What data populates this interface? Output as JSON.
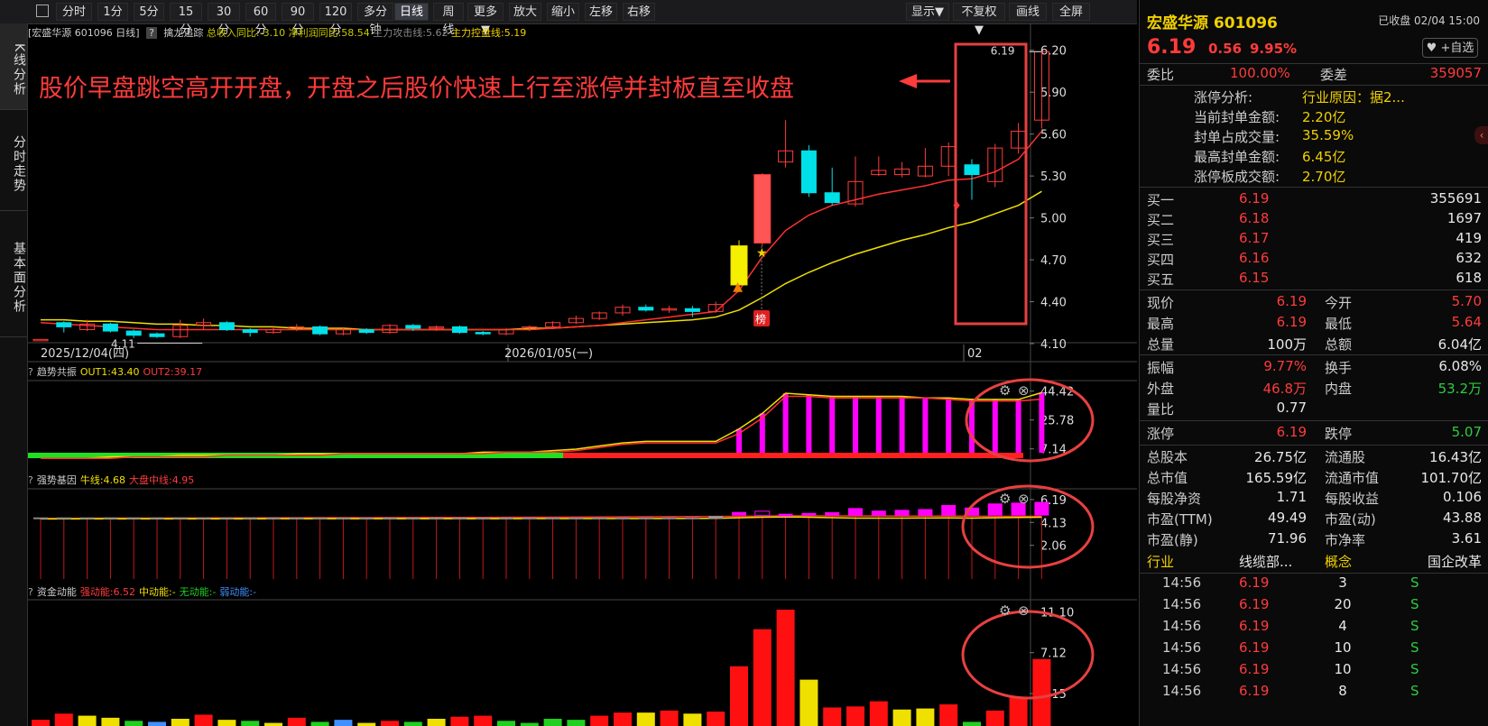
{
  "toolbar": {
    "buttons": [
      "分时",
      "1分",
      "5分",
      "15分",
      "30分",
      "60分",
      "90分",
      "120分",
      "多分钟",
      "日线",
      "周线",
      "更多▼",
      "放大",
      "缩小",
      "左移",
      "右移"
    ],
    "right_buttons": [
      "显示▼",
      "不复权▼",
      "画线",
      "全屏"
    ]
  },
  "left_tabs": [
    "K线分析",
    "分时走势",
    "基本面分析"
  ],
  "main_panel": {
    "header_title": "[宏盛华源 601096 日线]",
    "header_help": "?",
    "indicator_name": "擒龙追踪",
    "ind1": "总收入同比:-3.10",
    "ind2": "净利润同比:58.54",
    "ind3": "主力攻击线:5.62",
    "ind4": "主力控盘线:5.19",
    "annotation": "股价早盘跳空高开开盘，开盘之后股价快速上行至涨停并封板直至收盘",
    "last_price_label": "6.19",
    "min_label": "4.11",
    "bang_label": "榜",
    "y_ticks": [
      "6.20",
      "5.90",
      "5.60",
      "5.30",
      "5.00",
      "4.70",
      "4.40",
      "4.10"
    ],
    "x_dates": [
      "2025/12/04(四)",
      "2026/01/05(一)",
      "02"
    ]
  },
  "panel2": {
    "title": "趋势共振",
    "out1": "OUT1:43.40",
    "out2": "OUT2:39.17",
    "y_ticks": [
      "44.42",
      "25.78",
      "7.14"
    ]
  },
  "panel3": {
    "title": "强势基因",
    "niu": "牛线:4.68",
    "dapan": "大盘中线:4.95",
    "y_ticks": [
      "6.19",
      "4.13",
      "2.06"
    ]
  },
  "panel4": {
    "title": "资金动能",
    "strong": "强动能:6.52",
    "mid": "中动能:-",
    "none": "无动能:-",
    "weak": "弱动能:-",
    "y_ticks": [
      "11.10",
      "7.12",
      "3.15"
    ]
  },
  "chart_data": {
    "type": "candlestick",
    "candles": [
      [
        4.13,
        4.13,
        4.13,
        4.13
      ],
      [
        4.25,
        4.22,
        4.26,
        4.18
      ],
      [
        4.2,
        4.24,
        4.27,
        4.19
      ],
      [
        4.24,
        4.19,
        4.25,
        4.18
      ],
      [
        4.19,
        4.16,
        4.2,
        4.14
      ],
      [
        4.17,
        4.15,
        4.18,
        4.14
      ],
      [
        4.15,
        4.23,
        4.27,
        4.14
      ],
      [
        4.23,
        4.25,
        4.28,
        4.2
      ],
      [
        4.25,
        4.2,
        4.26,
        4.19
      ],
      [
        4.2,
        4.18,
        4.21,
        4.15
      ],
      [
        4.18,
        4.2,
        4.22,
        4.17
      ],
      [
        4.2,
        4.22,
        4.24,
        4.19
      ],
      [
        4.22,
        4.17,
        4.23,
        4.16
      ],
      [
        4.17,
        4.2,
        4.21,
        4.16
      ],
      [
        4.2,
        4.18,
        4.21,
        4.17
      ],
      [
        4.18,
        4.23,
        4.24,
        4.17
      ],
      [
        4.23,
        4.21,
        4.24,
        4.19
      ],
      [
        4.21,
        4.22,
        4.23,
        4.19
      ],
      [
        4.22,
        4.18,
        4.23,
        4.17
      ],
      [
        4.18,
        4.17,
        4.19,
        4.16
      ],
      [
        4.17,
        4.2,
        4.21,
        4.16
      ],
      [
        4.2,
        4.22,
        4.23,
        4.19
      ],
      [
        4.22,
        4.25,
        4.26,
        4.21
      ],
      [
        4.25,
        4.28,
        4.3,
        4.24
      ],
      [
        4.28,
        4.32,
        4.33,
        4.27
      ],
      [
        4.32,
        4.36,
        4.38,
        4.3
      ],
      [
        4.36,
        4.34,
        4.38,
        4.33
      ],
      [
        4.34,
        4.35,
        4.37,
        4.32
      ],
      [
        4.35,
        4.33,
        4.37,
        4.29
      ],
      [
        4.33,
        4.38,
        4.4,
        4.32
      ],
      [
        4.52,
        4.8,
        4.84,
        4.5
      ],
      [
        4.82,
        5.31,
        5.32,
        4.8
      ],
      [
        5.4,
        5.48,
        5.7,
        5.36
      ],
      [
        5.48,
        5.18,
        5.52,
        5.15
      ],
      [
        5.18,
        5.11,
        5.36,
        5.09
      ],
      [
        5.1,
        5.26,
        5.44,
        5.08
      ],
      [
        5.31,
        5.34,
        5.44,
        5.3
      ],
      [
        5.31,
        5.35,
        5.4,
        5.29
      ],
      [
        5.3,
        5.37,
        5.5,
        5.29
      ],
      [
        5.37,
        5.51,
        5.54,
        5.3
      ],
      [
        5.38,
        5.31,
        5.42,
        5.13
      ],
      [
        5.26,
        5.5,
        5.53,
        5.22
      ],
      [
        5.5,
        5.62,
        5.68,
        5.46
      ],
      [
        5.7,
        6.19,
        6.19,
        5.64
      ]
    ],
    "ma_red": [
      4.25,
      4.24,
      4.23,
      4.22,
      4.21,
      4.2,
      4.2,
      4.2,
      4.2,
      4.2,
      4.2,
      4.2,
      4.2,
      4.2,
      4.2,
      4.2,
      4.2,
      4.2,
      4.2,
      4.2,
      4.2,
      4.2,
      4.21,
      4.22,
      4.23,
      4.25,
      4.27,
      4.29,
      4.31,
      4.33,
      4.48,
      4.72,
      4.91,
      5.02,
      5.09,
      5.13,
      5.17,
      5.2,
      5.23,
      5.27,
      5.28,
      5.33,
      5.42,
      5.62
    ],
    "ma_yellow": [
      4.27,
      4.27,
      4.26,
      4.26,
      4.25,
      4.24,
      4.24,
      4.23,
      4.23,
      4.22,
      4.22,
      4.21,
      4.21,
      4.21,
      4.2,
      4.2,
      4.2,
      4.2,
      4.2,
      4.2,
      4.2,
      4.21,
      4.21,
      4.22,
      4.23,
      4.24,
      4.25,
      4.26,
      4.27,
      4.29,
      4.34,
      4.43,
      4.53,
      4.61,
      4.68,
      4.74,
      4.79,
      4.84,
      4.88,
      4.93,
      4.97,
      5.03,
      5.09,
      5.19
    ],
    "ylim": [
      4.1,
      6.25
    ],
    "p2_yellow": [
      1,
      1,
      1,
      2,
      2,
      2,
      3,
      3,
      3,
      3,
      3,
      4,
      4,
      4,
      4,
      4,
      4,
      4,
      4,
      5,
      5,
      5,
      6,
      7,
      9,
      11,
      12,
      12,
      12,
      12,
      20,
      30,
      43,
      42,
      41,
      41,
      41,
      41,
      40,
      40,
      39,
      39,
      39,
      43.4
    ],
    "p2_red": [
      1,
      1,
      1,
      1,
      2,
      2,
      2,
      2,
      3,
      3,
      3,
      3,
      3,
      4,
      4,
      4,
      4,
      4,
      4,
      4,
      5,
      5,
      5,
      6,
      8,
      10,
      11,
      11,
      11,
      11,
      17,
      27,
      41,
      41,
      40,
      40,
      40,
      40,
      40,
      39,
      38,
      38,
      38,
      39.17
    ],
    "p2_bars_from": 30,
    "p2_ylim": [
      0,
      50
    ],
    "p3_red": [
      4.48,
      4.5,
      4.5,
      4.52,
      4.52,
      4.52,
      4.53,
      4.53,
      4.54,
      4.54,
      4.55,
      4.55,
      4.56,
      4.56,
      4.56,
      4.57,
      4.57,
      4.58,
      4.58,
      4.58,
      4.59,
      4.6,
      4.6,
      4.61,
      4.62,
      4.63,
      4.64,
      4.65,
      4.66,
      4.67,
      4.68,
      4.7,
      4.72,
      4.72,
      4.72,
      4.71,
      4.71,
      4.7,
      4.7,
      4.7,
      4.69,
      4.68,
      4.68,
      4.68
    ],
    "p3_yellow": [
      4.45,
      4.45,
      4.46,
      4.46,
      4.46,
      4.46,
      4.46,
      4.46,
      4.46,
      4.46,
      4.47,
      4.47,
      4.47,
      4.47,
      4.47,
      4.47,
      4.47,
      4.47,
      4.47,
      4.47,
      4.47,
      4.48,
      4.48,
      4.48,
      4.48,
      4.48,
      4.48,
      4.49,
      4.49,
      4.5,
      4.55,
      4.6,
      4.62,
      4.6,
      4.56,
      4.52,
      4.52,
      4.52,
      4.53,
      4.54,
      4.52,
      4.55,
      4.58,
      4.6
    ],
    "p3_ylim": [
      0,
      7
    ],
    "p4_values": [
      0.6,
      1.2,
      1.0,
      0.8,
      0.5,
      0.4,
      0.7,
      1.1,
      0.6,
      0.5,
      0.3,
      0.8,
      0.4,
      0.6,
      0.3,
      0.5,
      0.4,
      0.7,
      0.9,
      1.0,
      0.5,
      0.3,
      0.7,
      0.6,
      1.0,
      1.3,
      1.3,
      1.5,
      1.2,
      1.4,
      5.8,
      9.4,
      11.3,
      4.5,
      1.8,
      1.9,
      2.4,
      1.6,
      1.7,
      2.1,
      0.4,
      1.5,
      2.8,
      6.5
    ],
    "p4_colors": [
      "r",
      "r",
      "y",
      "y",
      "g",
      "b",
      "y",
      "r",
      "y",
      "g",
      "y",
      "r",
      "g",
      "b",
      "y",
      "r",
      "g",
      "y",
      "r",
      "r",
      "g",
      "g",
      "g",
      "g",
      "r",
      "r",
      "y",
      "r",
      "y",
      "r",
      "r",
      "r",
      "r",
      "y",
      "r",
      "r",
      "r",
      "y",
      "y",
      "r",
      "g",
      "r",
      "r",
      "r"
    ],
    "p4_ylim": [
      0,
      12
    ]
  },
  "quote": {
    "name": "宏盛华源 601096",
    "status": "已收盘 02/04 15:00",
    "price": "6.19",
    "change": "0.56",
    "pct": "9.95%",
    "fav": "+自选",
    "weibi_label": "委比",
    "weibi": "100.00%",
    "weicha_label": "委差",
    "weicha": "359057",
    "zt_info": [
      {
        "label": "涨停分析:",
        "value": "行业原因：据2..."
      },
      {
        "label": "当前封单金额:",
        "value": "2.20亿"
      },
      {
        "label": "封单占成交量:",
        "value": "35.59%"
      },
      {
        "label": "最高封单金额:",
        "value": "6.45亿"
      },
      {
        "label": "涨停板成交额:",
        "value": "2.70亿"
      }
    ],
    "bids": [
      {
        "label": "买一",
        "price": "6.19",
        "vol": "355691"
      },
      {
        "label": "买二",
        "price": "6.18",
        "vol": "1697"
      },
      {
        "label": "买三",
        "price": "6.17",
        "vol": "419"
      },
      {
        "label": "买四",
        "price": "6.16",
        "vol": "632"
      },
      {
        "label": "买五",
        "price": "6.15",
        "vol": "618"
      }
    ],
    "stats1": [
      {
        "l1": "现价",
        "v1": "6.19",
        "c1": "red",
        "l2": "今开",
        "v2": "5.70",
        "c2": "red"
      },
      {
        "l1": "最高",
        "v1": "6.19",
        "c1": "red",
        "l2": "最低",
        "v2": "5.64",
        "c2": "red"
      },
      {
        "l1": "总量",
        "v1": "100万",
        "c1": "white",
        "l2": "总额",
        "v2": "6.04亿",
        "c2": "white"
      }
    ],
    "stats2": [
      {
        "l1": "振幅",
        "v1": "9.77%",
        "c1": "red",
        "l2": "换手",
        "v2": "6.08%",
        "c2": "white"
      },
      {
        "l1": "外盘",
        "v1": "46.8万",
        "c1": "red",
        "l2": "内盘",
        "v2": "53.2万",
        "c2": "green"
      },
      {
        "l1": "量比",
        "v1": "0.77",
        "c1": "white",
        "l2": "",
        "v2": "",
        "c2": "white"
      }
    ],
    "stats3": [
      {
        "l1": "涨停",
        "v1": "6.19",
        "c1": "red",
        "l2": "跌停",
        "v2": "5.07",
        "c2": "green"
      }
    ],
    "stats4": [
      {
        "l1": "总股本",
        "v1": "26.75亿",
        "l2": "流通股",
        "v2": "16.43亿"
      },
      {
        "l1": "总市值",
        "v1": "165.59亿",
        "l2": "流通市值",
        "v2": "101.70亿"
      },
      {
        "l1": "每股净资",
        "v1": "1.71",
        "l2": "每股收益",
        "v2": "0.106"
      },
      {
        "l1": "市盈(TTM)",
        "v1": "49.49",
        "l2": "市盈(动)",
        "v2": "43.88"
      },
      {
        "l1": "市盈(静)",
        "v1": "71.96",
        "l2": "市净率",
        "v2": "3.61"
      }
    ],
    "industry_label": "行业",
    "industry": "线缆部...",
    "concept_label": "概念",
    "concept": "国企改革",
    "ticks": [
      {
        "time": "14:56",
        "price": "6.19",
        "vol": "3",
        "side": "S"
      },
      {
        "time": "14:56",
        "price": "6.19",
        "vol": "20",
        "side": "S"
      },
      {
        "time": "14:56",
        "price": "6.19",
        "vol": "4",
        "side": "S"
      },
      {
        "time": "14:56",
        "price": "6.19",
        "vol": "10",
        "side": "S"
      },
      {
        "time": "14:56",
        "price": "6.19",
        "vol": "10",
        "side": "S"
      },
      {
        "time": "14:56",
        "price": "6.19",
        "vol": "8",
        "side": "S"
      }
    ]
  }
}
